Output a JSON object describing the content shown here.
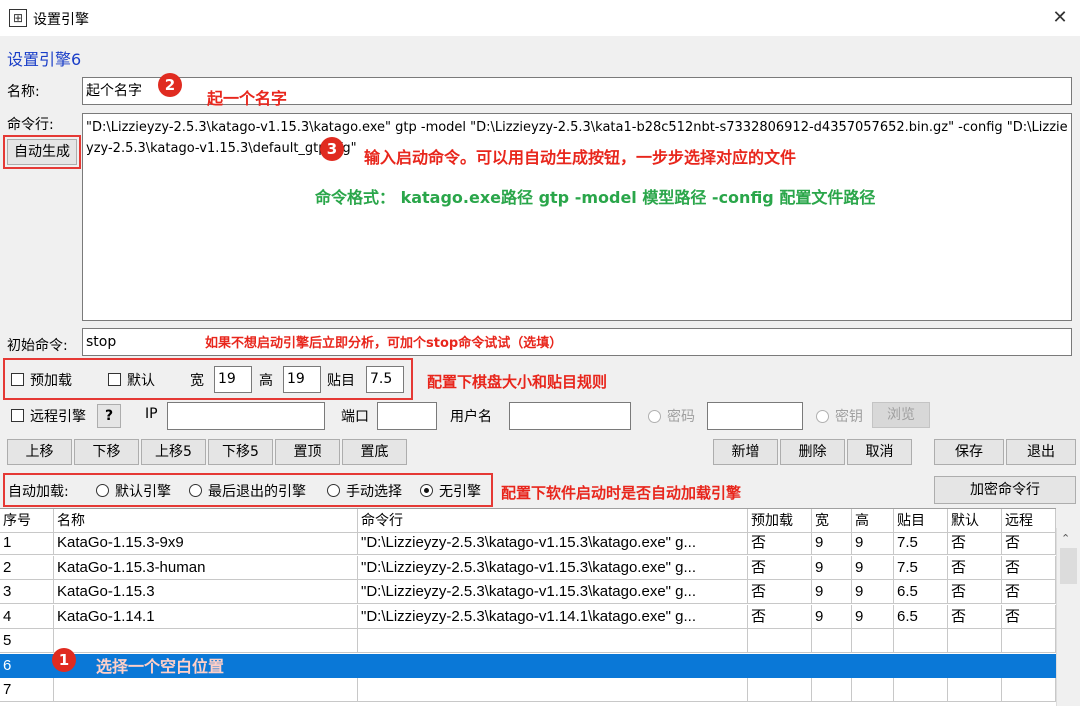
{
  "window": {
    "title": "设置引擎",
    "icon": "go-board-icon",
    "close": "✕"
  },
  "heading": "设置引擎6",
  "name": {
    "label": "名称:",
    "value": "起个名字",
    "note": "起一个名字",
    "bubble": "2"
  },
  "cmd": {
    "label": "命令行:",
    "auto_btn": "自动生成",
    "value": "\"D:\\Lizzieyzy-2.5.3\\katago-v1.15.3\\katago.exe\" gtp -model \"D:\\Lizzieyzy-2.5.3\\kata1-b28c512nbt-s7332806912-d4357057652.bin.gz\" -config \"D:\\Lizzieyzy-2.5.3\\katago-v1.15.3\\default_gtp.cfg\"",
    "bubble": "3",
    "note": "输入启动命令。可以用自动生成按钮，一步步选择对应的文件",
    "format_note": "命令格式： katago.exe路径 gtp -model 模型路径 -config 配置文件路径"
  },
  "init": {
    "label": "初始命令:",
    "value": "stop",
    "note": "如果不想启动引擎后立即分析，可加个stop命令试试（选填）"
  },
  "board": {
    "preload_label": "预加载",
    "default_label": "默认",
    "width_label": "宽",
    "width": "19",
    "height_label": "高",
    "height": "19",
    "komi_label": "贴目",
    "komi": "7.5",
    "note": "配置下棋盘大小和贴目规则"
  },
  "remote": {
    "label": "远程引擎",
    "help": "?",
    "ip_label": "IP",
    "port_label": "端口",
    "user_label": "用户名",
    "password_label": "密码",
    "key_label": "密钥",
    "browse": "浏览"
  },
  "buttons": {
    "up": "上移",
    "down": "下移",
    "up5": "上移5",
    "down5": "下移5",
    "top": "置顶",
    "bottom": "置底",
    "add": "新增",
    "delete": "删除",
    "cancel": "取消",
    "save": "保存",
    "exit": "退出",
    "encrypt": "加密命令行"
  },
  "autoload": {
    "label": "自动加载:",
    "options": [
      "默认引擎",
      "最后退出的引擎",
      "手动选择",
      "无引擎"
    ],
    "selected": "无引擎",
    "note": "配置下软件启动时是否自动加载引擎"
  },
  "table": {
    "headers": [
      "序号",
      "名称",
      "命令行",
      "预加载",
      "宽",
      "高",
      "贴目",
      "默认",
      "远程"
    ],
    "rows": [
      [
        "1",
        "KataGo-1.15.3-9x9",
        "\"D:\\Lizzieyzy-2.5.3\\katago-v1.15.3\\katago.exe\" g...",
        "否",
        "9",
        "9",
        "7.5",
        "否",
        "否"
      ],
      [
        "2",
        "KataGo-1.15.3-human",
        "\"D:\\Lizzieyzy-2.5.3\\katago-v1.15.3\\katago.exe\" g...",
        "否",
        "9",
        "9",
        "7.5",
        "否",
        "否"
      ],
      [
        "3",
        "KataGo-1.15.3",
        "\"D:\\Lizzieyzy-2.5.3\\katago-v1.15.3\\katago.exe\" g...",
        "否",
        "9",
        "9",
        "6.5",
        "否",
        "否"
      ],
      [
        "4",
        "KataGo-1.14.1",
        "\"D:\\Lizzieyzy-2.5.3\\katago-v1.14.1\\katago.exe\" g...",
        "否",
        "9",
        "9",
        "6.5",
        "否",
        "否"
      ],
      [
        "5",
        "",
        "",
        "",
        "",
        "",
        "",
        "",
        ""
      ],
      [
        "6",
        "",
        "",
        "",
        "",
        "",
        "",
        "",
        ""
      ],
      [
        "7",
        "",
        "",
        "",
        "",
        "",
        "",
        "",
        ""
      ]
    ],
    "selected_row": "6",
    "select_note": "选择一个空白位置",
    "bubble": "1"
  },
  "colors": {
    "annotation_red": "#e8261c",
    "annotation_green": "#2aa64a",
    "selection": "#0a78d7",
    "heading": "#1a3ec8"
  }
}
